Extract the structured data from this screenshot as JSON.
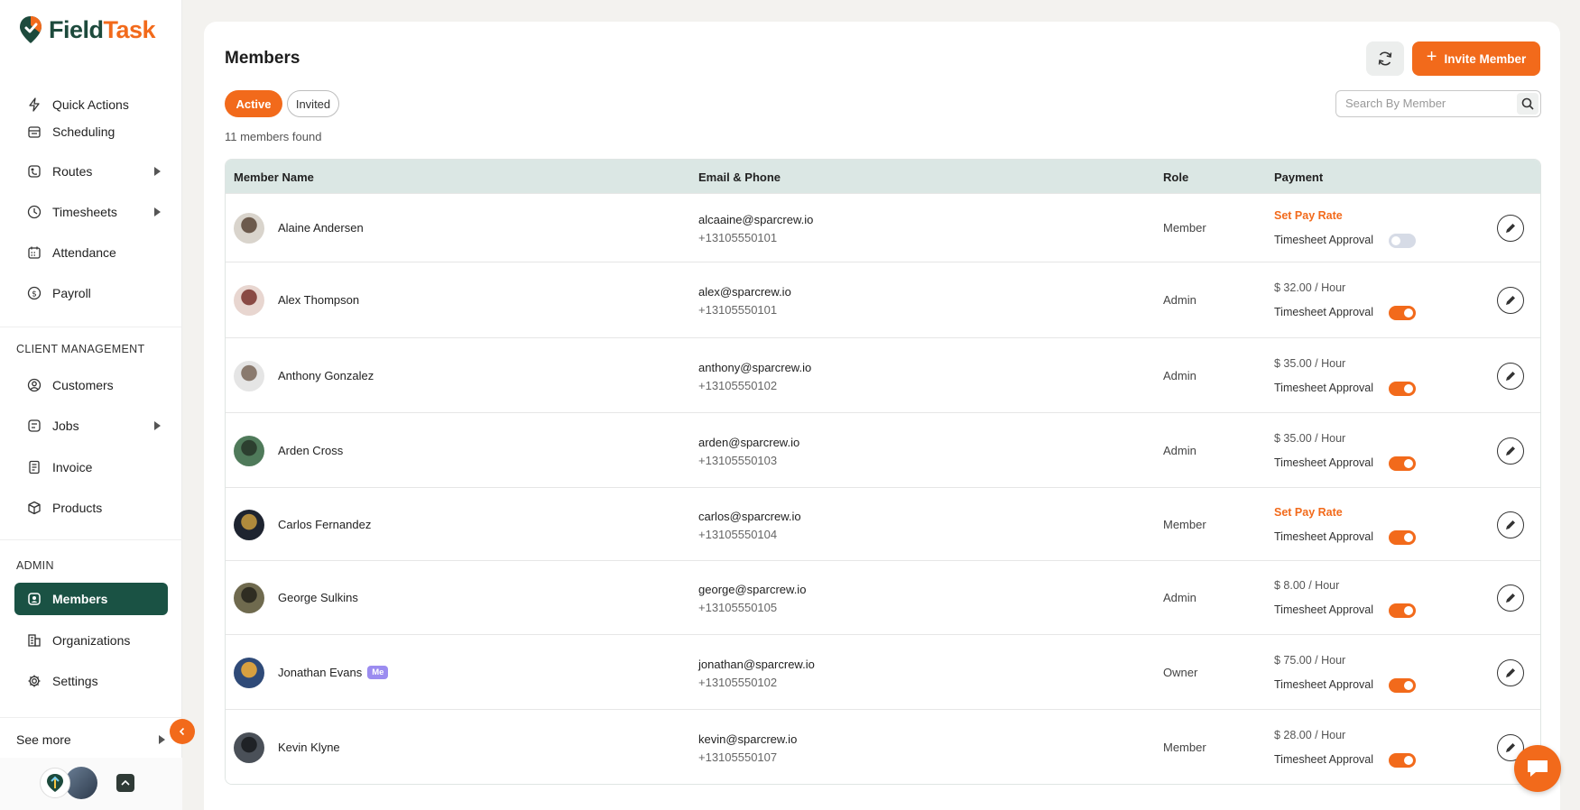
{
  "app": {
    "name_part1": "Field",
    "name_part2": "Task"
  },
  "sidebar": {
    "items_top": [
      {
        "label": "Quick Actions",
        "icon": "bolt-icon"
      },
      {
        "label": "Scheduling",
        "icon": "calendar-icon"
      },
      {
        "label": "Routes",
        "icon": "route-icon",
        "has_submenu": true
      },
      {
        "label": "Timesheets",
        "icon": "clock-icon",
        "has_submenu": true
      },
      {
        "label": "Attendance",
        "icon": "attendance-icon"
      },
      {
        "label": "Payroll",
        "icon": "dollar-icon"
      }
    ],
    "client_section_label": "CLIENT MANAGEMENT",
    "items_client": [
      {
        "label": "Customers",
        "icon": "user-circle-icon"
      },
      {
        "label": "Jobs",
        "icon": "jobs-icon",
        "has_submenu": true
      },
      {
        "label": "Invoice",
        "icon": "invoice-icon"
      },
      {
        "label": "Products",
        "icon": "box-icon"
      }
    ],
    "admin_section_label": "ADMIN",
    "items_admin": [
      {
        "label": "Members",
        "icon": "members-icon",
        "active": true
      },
      {
        "label": "Organizations",
        "icon": "building-icon"
      },
      {
        "label": "Settings",
        "icon": "gear-icon"
      }
    ],
    "see_more": "See more"
  },
  "page": {
    "title": "Members",
    "invite_button": "Invite Member",
    "tabs": {
      "active": "Active",
      "invited": "Invited"
    },
    "search_placeholder": "Search By Member",
    "count_text": "11 members found"
  },
  "table": {
    "headers": {
      "name": "Member Name",
      "contact": "Email & Phone",
      "role": "Role",
      "payment": "Payment"
    },
    "approval_label": "Timesheet Approval",
    "rows": [
      {
        "name": "Alaine Andersen",
        "email": "alcaaine@sparcrew.io",
        "phone": "+13105550101",
        "role": "Member",
        "pay": "Set Pay Rate",
        "pay_set": false,
        "approval": false,
        "me": false
      },
      {
        "name": "Alex Thompson",
        "email": "alex@sparcrew.io",
        "phone": "+13105550101",
        "role": "Admin",
        "pay": "$ 32.00 / Hour",
        "pay_set": true,
        "approval": true,
        "me": false
      },
      {
        "name": "Anthony Gonzalez",
        "email": "anthony@sparcrew.io",
        "phone": "+13105550102",
        "role": "Admin",
        "pay": "$ 35.00 / Hour",
        "pay_set": true,
        "approval": true,
        "me": false
      },
      {
        "name": "Arden Cross",
        "email": "arden@sparcrew.io",
        "phone": "+13105550103",
        "role": "Admin",
        "pay": "$ 35.00 / Hour",
        "pay_set": true,
        "approval": true,
        "me": false
      },
      {
        "name": "Carlos Fernandez",
        "email": "carlos@sparcrew.io",
        "phone": "+13105550104",
        "role": "Member",
        "pay": "Set Pay Rate",
        "pay_set": false,
        "approval": true,
        "me": false
      },
      {
        "name": "George Sulkins",
        "email": "george@sparcrew.io",
        "phone": "+13105550105",
        "role": "Admin",
        "pay": "$ 8.00 / Hour",
        "pay_set": true,
        "approval": true,
        "me": false
      },
      {
        "name": "Jonathan Evans",
        "email": "jonathan@sparcrew.io",
        "phone": "+13105550102",
        "role": "Owner",
        "pay": "$ 75.00 / Hour",
        "pay_set": true,
        "approval": true,
        "me": true,
        "me_label": "Me"
      },
      {
        "name": "Kevin Klyne",
        "email": "kevin@sparcrew.io",
        "phone": "+13105550107",
        "role": "Member",
        "pay": "$ 28.00 / Hour",
        "pay_set": true,
        "approval": true,
        "me": false
      }
    ]
  },
  "colors": {
    "accent": "#f26a1b",
    "brand": "#1a5244",
    "header_bg": "#dbe7e4"
  }
}
